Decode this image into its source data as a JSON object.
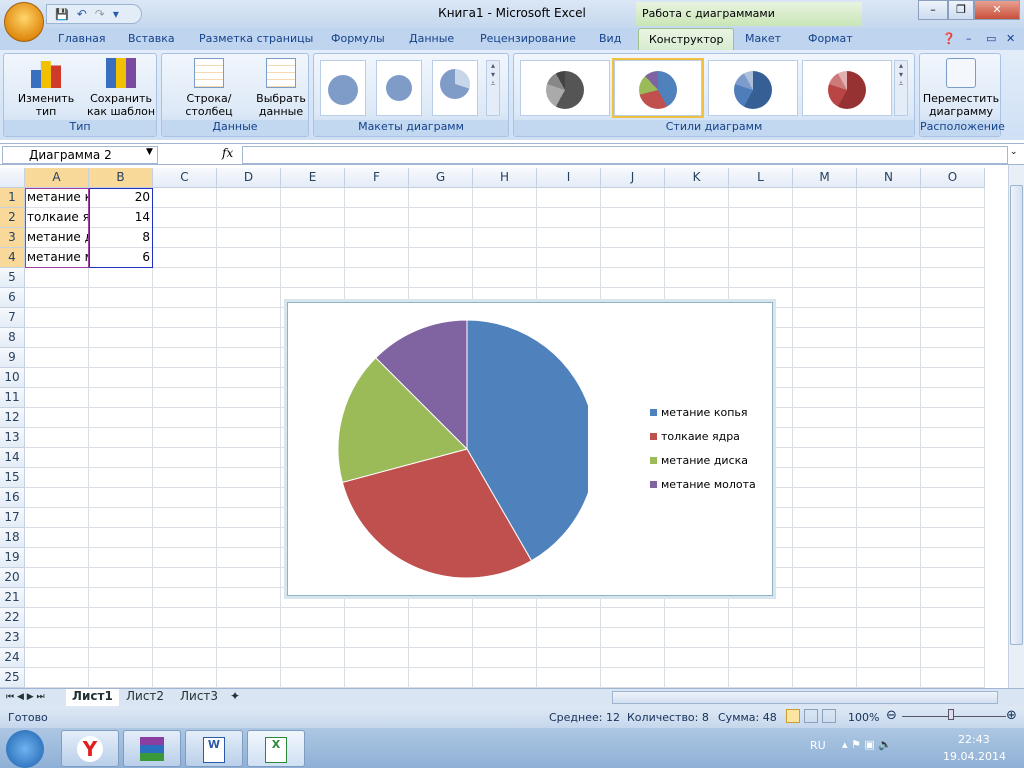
{
  "window": {
    "title": "Книга1  -  Microsoft Excel",
    "context_title": "Работа с диаграммами",
    "min": "–",
    "restore": "❐",
    "close": "✕"
  },
  "qat": {
    "save": "💾",
    "undo": "↶",
    "redo": "↷",
    "more": "▾"
  },
  "tabs": [
    "Главная",
    "Вставка",
    "Разметка страницы",
    "Формулы",
    "Данные",
    "Рецензирование",
    "Вид",
    "Конструктор",
    "Макет",
    "Формат"
  ],
  "active_tab": "Конструктор",
  "ribbon": {
    "groups": {
      "type": "Тип",
      "data": "Данные",
      "layouts": "Макеты диаграмм",
      "styles": "Стили диаграмм",
      "location": "Расположение"
    },
    "buttons": {
      "change_type": "Изменить тип диаграммы",
      "save_template": "Сохранить как шаблон",
      "row_col": "Строка/столбец",
      "select_data": "Выбрать данные",
      "move_chart": "Переместить диаграмму"
    }
  },
  "formula_bar": {
    "name_box": "Диаграмма 2",
    "fx": "fx",
    "value": ""
  },
  "columns": [
    "A",
    "B",
    "C",
    "D",
    "E",
    "F",
    "G",
    "H",
    "I",
    "J",
    "K",
    "L",
    "M",
    "N",
    "O"
  ],
  "rows": 25,
  "cells": [
    [
      "метание копья",
      20
    ],
    [
      "толкаие ядра",
      14
    ],
    [
      "метание диска",
      8
    ],
    [
      "метание молота",
      6
    ]
  ],
  "cells_visible": [
    "метание к",
    "толкаие я",
    "метание д",
    "метание м"
  ],
  "sheets": [
    "Лист1",
    "Лист2",
    "Лист3"
  ],
  "active_sheet": "Лист1",
  "status": {
    "ready": "Готово",
    "average": "Среднее: 12",
    "count": "Количество: 8",
    "sum": "Сумма: 48",
    "zoom": "100%"
  },
  "taskbar": {
    "lang": "RU",
    "time": "22:43",
    "date": "19.04.2014",
    "apps": [
      "start",
      "yandex-browser",
      "winrar",
      "word",
      "excel"
    ]
  },
  "chart_data": {
    "type": "pie",
    "categories": [
      "метание копья",
      "толкаие ядра",
      "метание диска",
      "метание молота"
    ],
    "values": [
      20,
      14,
      8,
      6
    ],
    "colors": [
      "#4f81bd",
      "#c0504d",
      "#9bbb59",
      "#8064a2"
    ],
    "legend": "right"
  }
}
